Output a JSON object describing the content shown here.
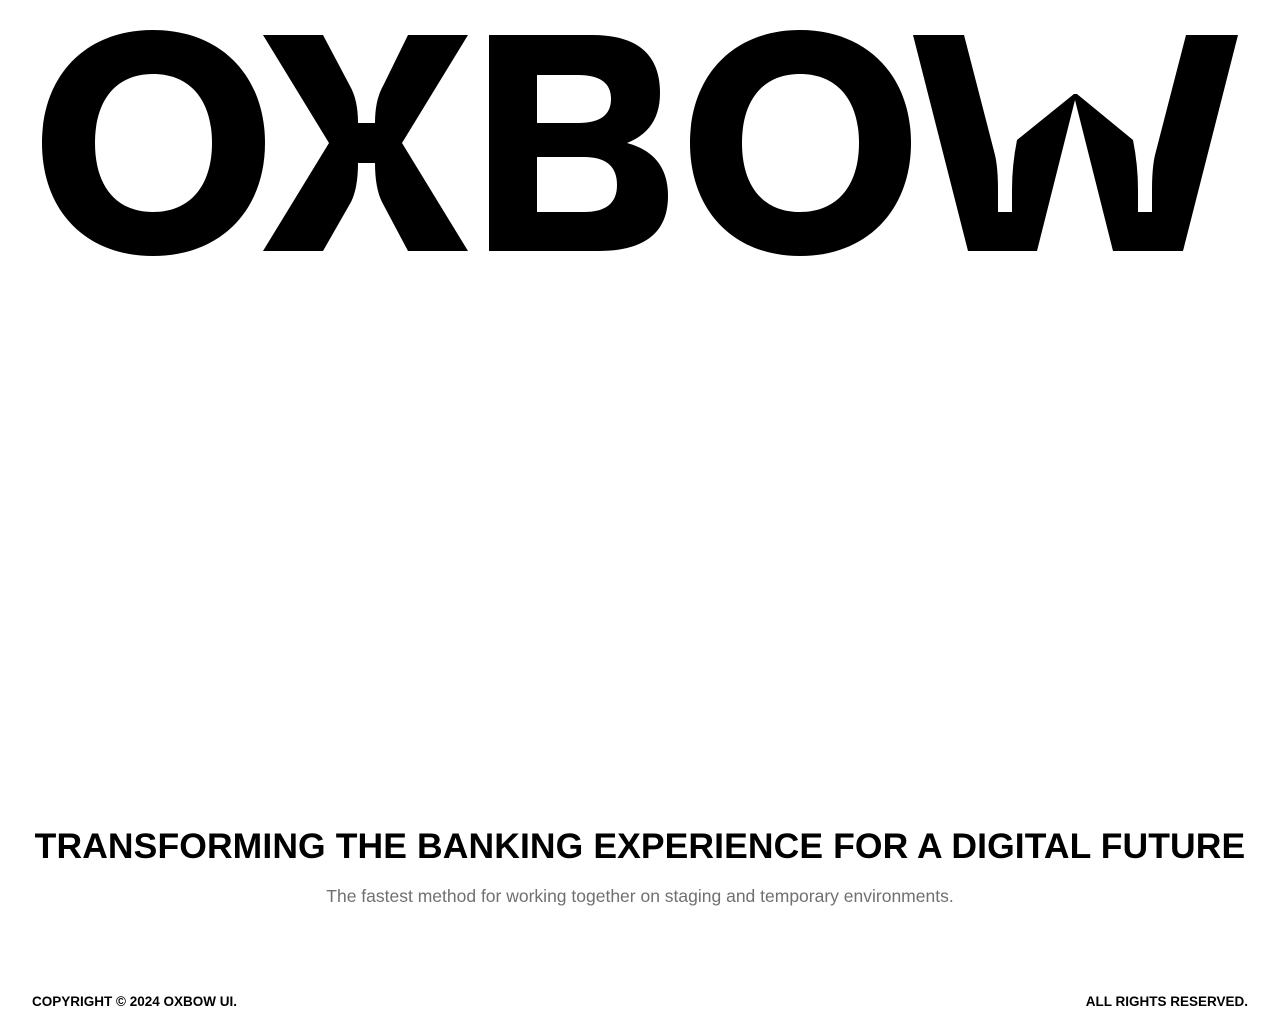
{
  "brand": {
    "logo_text": "OXBOW"
  },
  "hero": {
    "headline": "TRANSFORMING THE BANKING EXPERIENCE FOR A DIGITAL FUTURE",
    "subline": "The fastest method for working together on staging and temporary environments."
  },
  "footer": {
    "copyright": "COPYRIGHT © 2024 OXBOW UI.",
    "rights": "ALL RIGHTS RESERVED."
  },
  "colors": {
    "background": "#ffffff",
    "text": "#000000",
    "muted_text": "#707070"
  }
}
